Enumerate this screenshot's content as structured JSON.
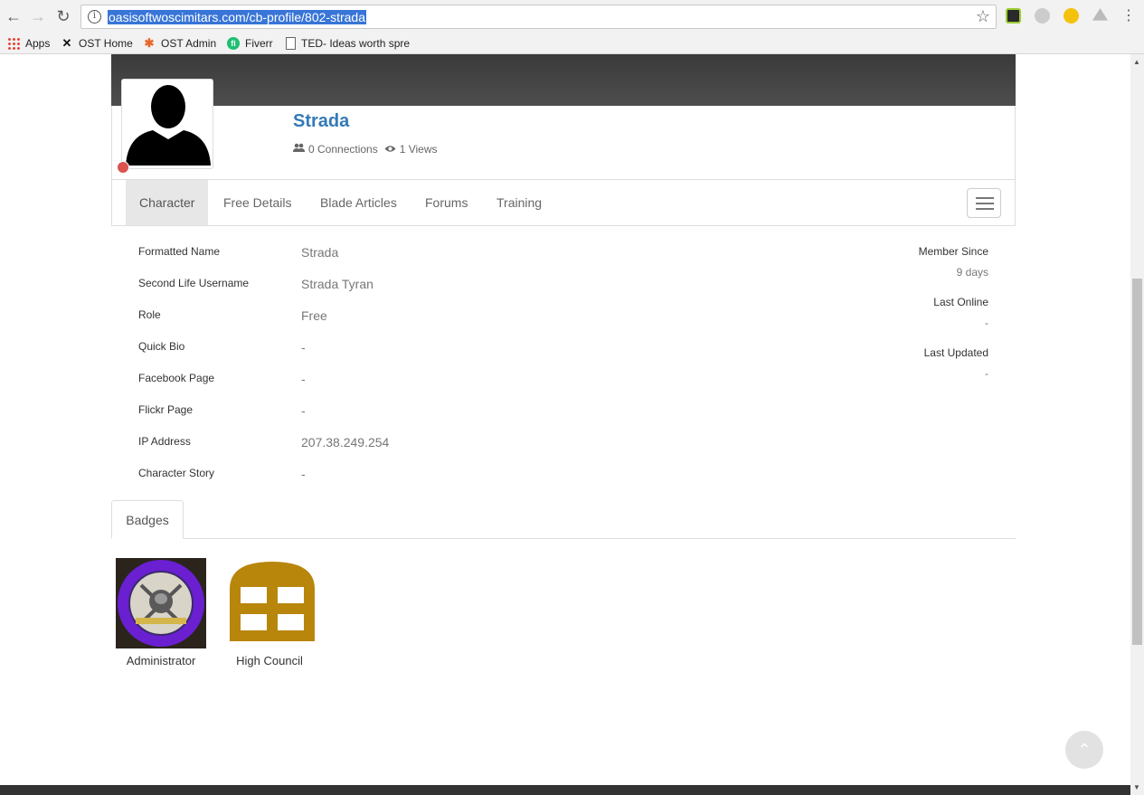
{
  "browser": {
    "url": "oasisoftwoscimitars.com/cb-profile/802-strada",
    "bookmarks": [
      {
        "label": "Apps"
      },
      {
        "label": "OST Home"
      },
      {
        "label": "OST Admin"
      },
      {
        "label": "Fiverr"
      },
      {
        "label": "TED- Ideas worth spre"
      }
    ]
  },
  "profile": {
    "name": "Strada",
    "connections": "0 Connections",
    "views": "1 Views",
    "status_color": "#d9534f"
  },
  "tabs": [
    "Character",
    "Free Details",
    "Blade Articles",
    "Forums",
    "Training"
  ],
  "fields": [
    {
      "label": "Formatted Name",
      "value": "Strada"
    },
    {
      "label": "Second Life Username",
      "value": "Strada Tyran"
    },
    {
      "label": "Role",
      "value": "Free"
    },
    {
      "label": "Quick Bio",
      "value": "-"
    },
    {
      "label": "Facebook Page",
      "value": "-"
    },
    {
      "label": "Flickr Page",
      "value": "-"
    },
    {
      "label": "IP Address",
      "value": "207.38.249.254"
    },
    {
      "label": "Character Story",
      "value": "-"
    }
  ],
  "side": {
    "member_since_label": "Member Since",
    "member_since_value": "9 days",
    "last_online_label": "Last Online",
    "last_online_value": "-",
    "last_updated_label": "Last Updated",
    "last_updated_value": "-"
  },
  "badges": {
    "tab_label": "Badges",
    "items": [
      {
        "caption": "Administrator",
        "icon": "crest-emblem"
      },
      {
        "caption": "High Council",
        "icon": "gold-window-icon"
      }
    ]
  },
  "colors": {
    "link": "#337ab7",
    "badge_gold": "#b8860b",
    "crest_purple": "#6a1fd1"
  }
}
